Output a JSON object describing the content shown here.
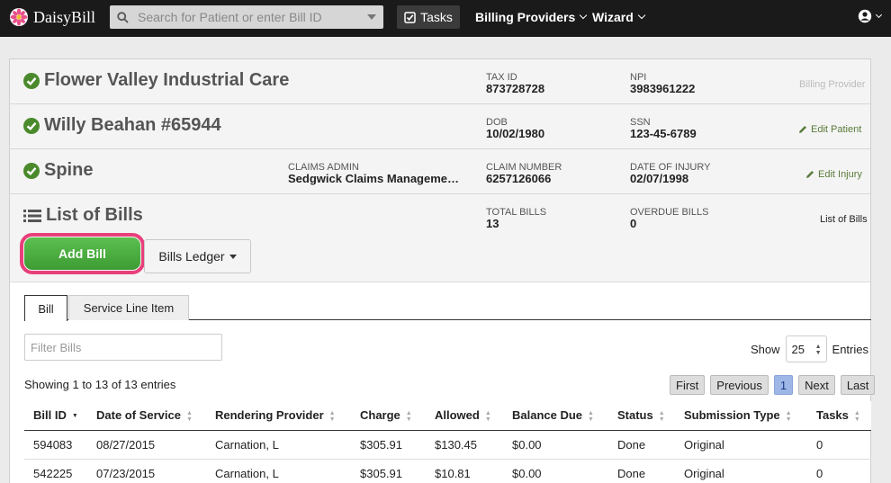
{
  "topnav": {
    "brand": "DaisyBill",
    "search_placeholder": "Search for Patient or enter Bill ID",
    "tasks_label": "Tasks",
    "billing_providers_label": "Billing Providers",
    "wizard_label": "Wizard"
  },
  "provider": {
    "name": "Flower Valley Industrial Care",
    "tax_id_label": "TAX ID",
    "tax_id": "873728728",
    "npi_label": "NPI",
    "npi": "3983961222",
    "action": "Billing Provider"
  },
  "patient": {
    "name": "Willy Beahan #65944",
    "dob_label": "DOB",
    "dob": "10/02/1980",
    "ssn_label": "SSN",
    "ssn": "123-45-6789",
    "action": "Edit Patient"
  },
  "injury": {
    "name": "Spine",
    "claims_admin_label": "CLAIMS ADMIN",
    "claims_admin": "Sedgwick Claims Manageme…",
    "claim_number_label": "CLAIM NUMBER",
    "claim_number": "6257126066",
    "doi_label": "DATE OF INJURY",
    "doi": "02/07/1998",
    "action": "Edit Injury"
  },
  "bills": {
    "title": "List of Bills",
    "total_label": "TOTAL BILLS",
    "total": "13",
    "overdue_label": "OVERDUE BILLS",
    "overdue": "0",
    "breadcrumb": "List of Bills",
    "add_bill_label": "Add Bill",
    "ledger_label": "Bills Ledger",
    "tabs": [
      "Bill",
      "Service Line Item"
    ],
    "filter_placeholder": "Filter Bills",
    "show_label": "Show",
    "page_size": "25",
    "entries_label": "Entries",
    "showing_text": "Showing 1 to 13 of 13 entries",
    "pager": {
      "first": "First",
      "previous": "Previous",
      "current": "1",
      "next": "Next",
      "last": "Last"
    },
    "columns": [
      "Bill ID",
      "Date of Service",
      "Rendering Provider",
      "Charge",
      "Allowed",
      "Balance Due",
      "Status",
      "Submission Type",
      "Tasks"
    ],
    "rows": [
      [
        "594083",
        "08/27/2015",
        "Carnation, L",
        "$305.91",
        "$130.45",
        "$0.00",
        "Done",
        "Original",
        "0"
      ],
      [
        "542225",
        "07/23/2015",
        "Carnation, L",
        "$305.91",
        "$10.81",
        "$0.00",
        "Done",
        "Original",
        "0"
      ]
    ]
  },
  "colors": {
    "nav_bg": "#1a1a1a",
    "check_green": "#4a8a2c",
    "add_bill_green": "#4cae40",
    "highlight_pink": "#e83f7a",
    "current_page": "#9fb7e6"
  },
  "icons": [
    "daisy-logo-icon",
    "search-icon",
    "check-square-icon",
    "user-circle-icon",
    "check-circle-icon",
    "pencil-icon",
    "list-icon",
    "sort-icon"
  ]
}
